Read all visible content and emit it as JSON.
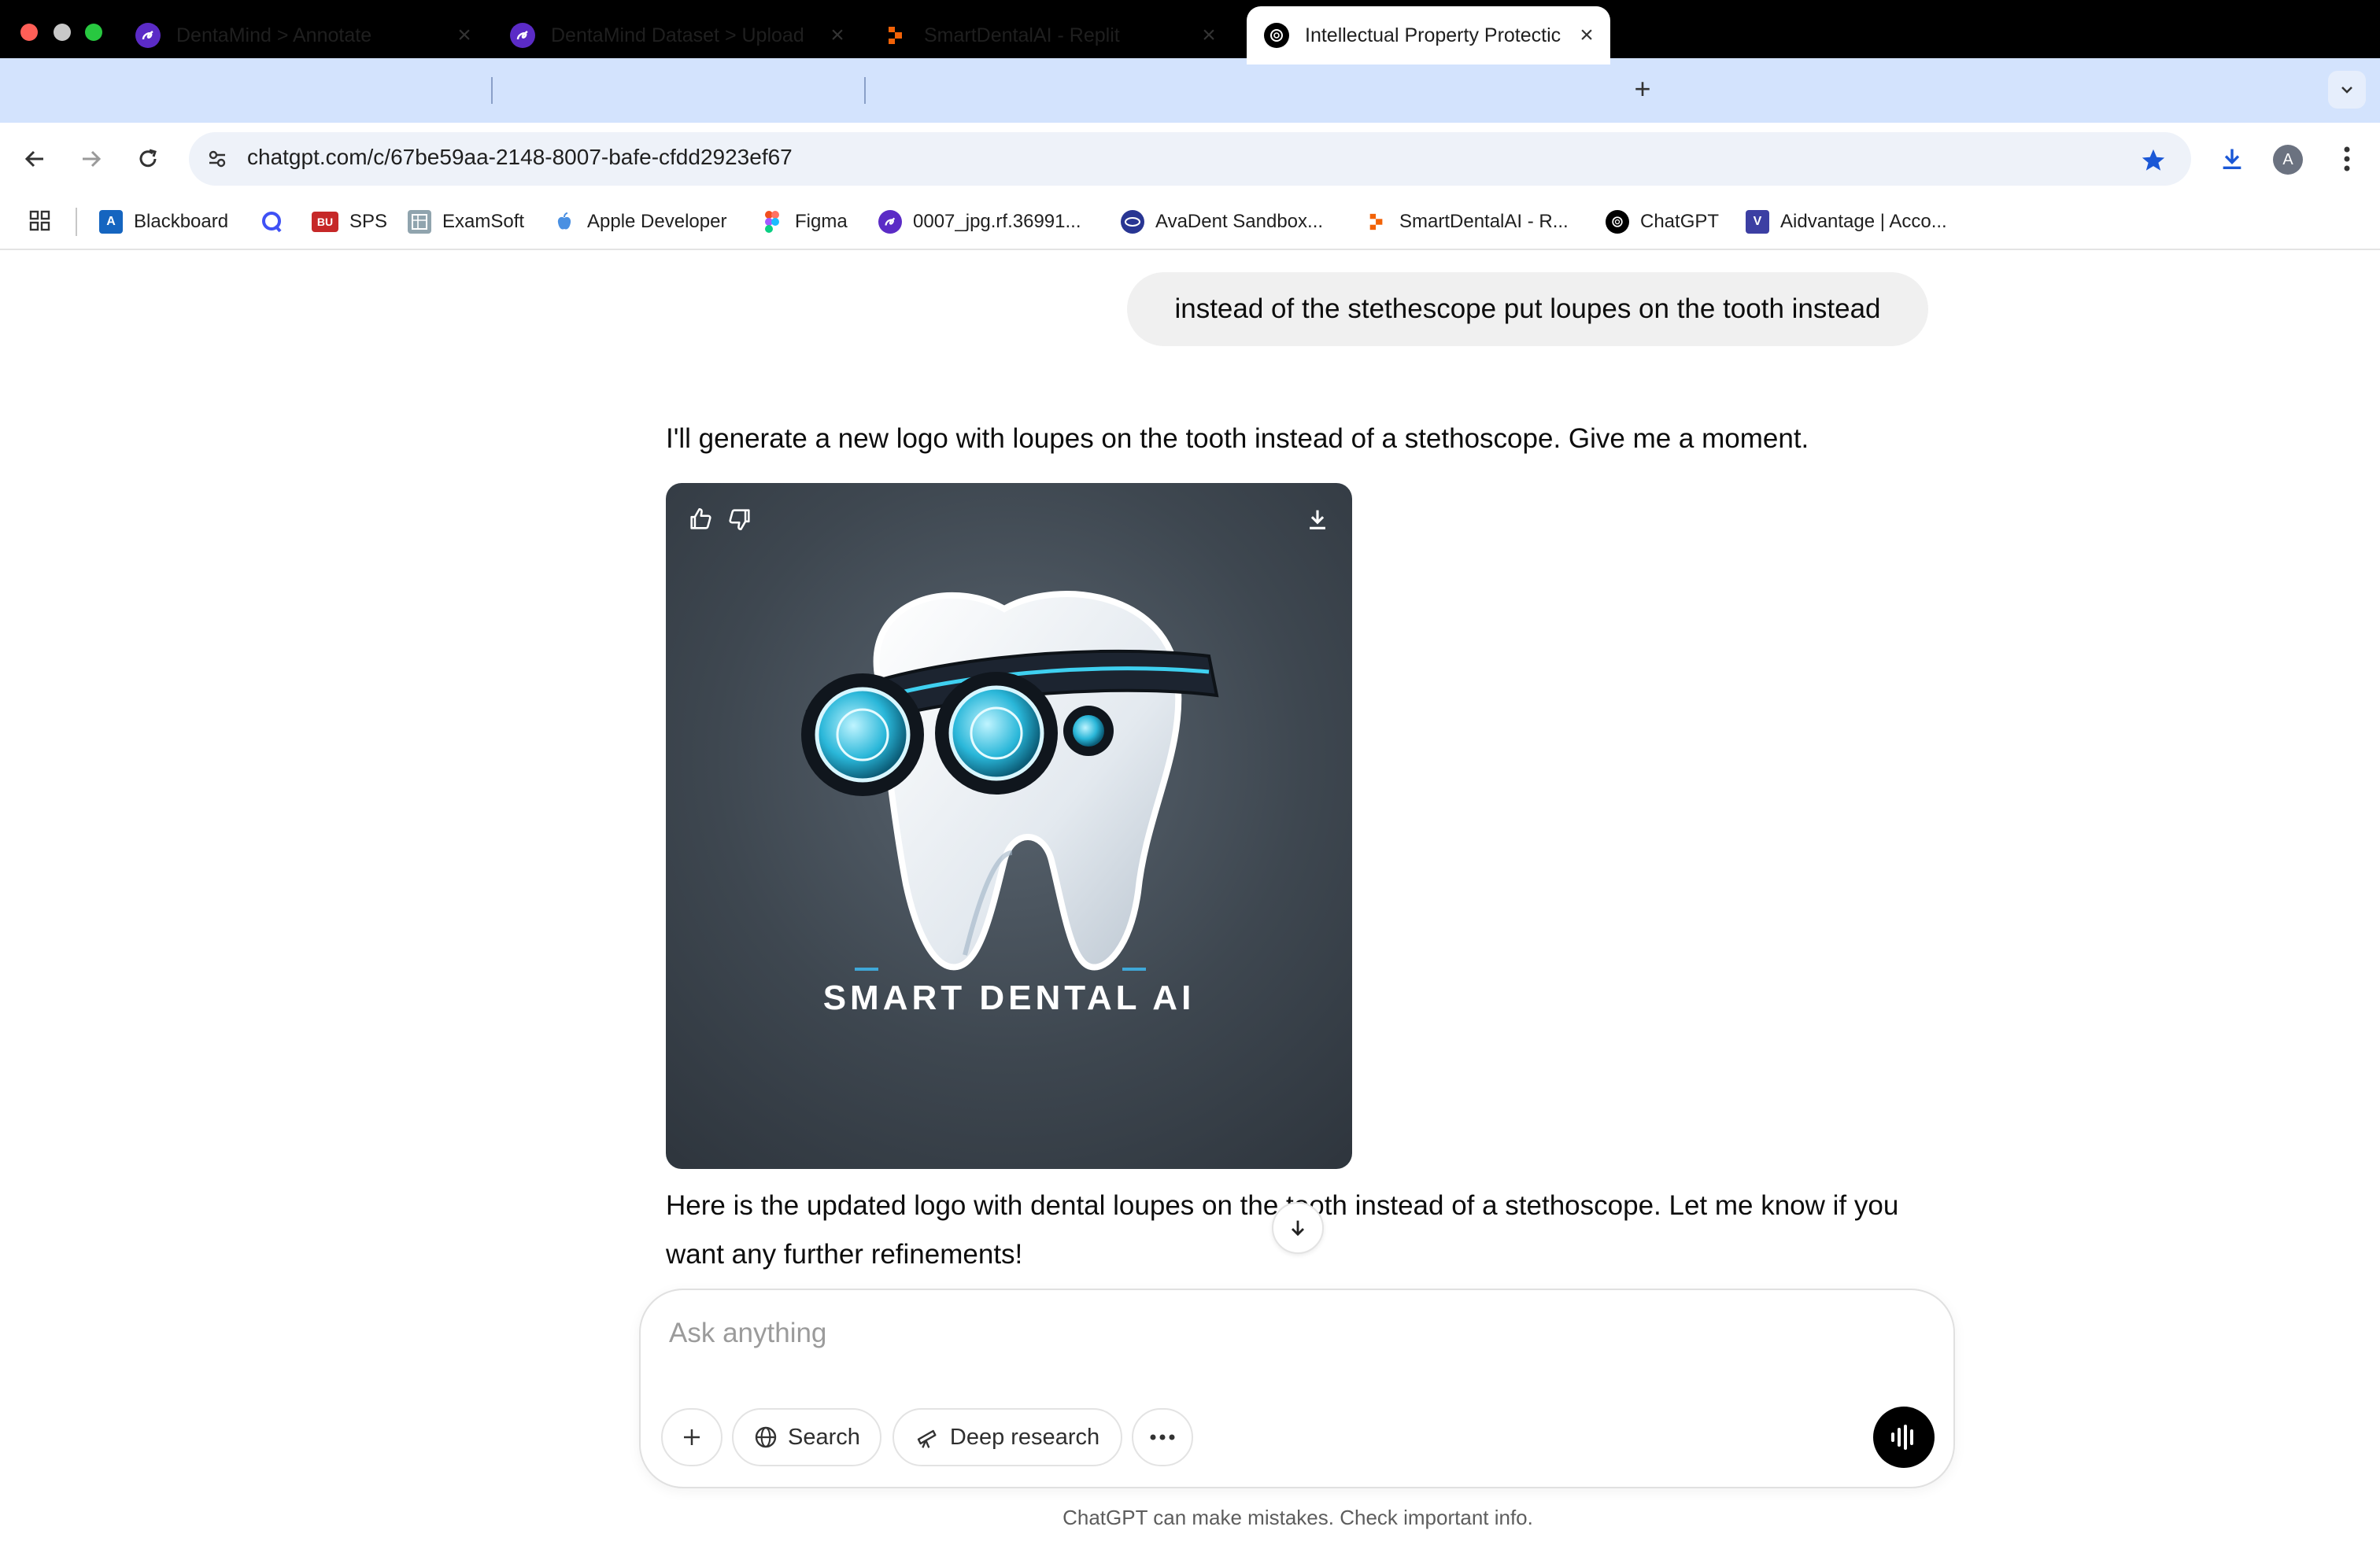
{
  "browser": {
    "tabs": [
      {
        "label": "DentaMind > Annotate",
        "icon": "dentamind-icon"
      },
      {
        "label": "DentaMind Dataset > Upload",
        "icon": "dentamind-icon"
      },
      {
        "label": "SmartDentalAI - Replit",
        "icon": "replit-icon"
      },
      {
        "label": "Intellectual Property Protectic",
        "icon": "chatgpt-icon",
        "active": true
      }
    ],
    "url": "chatgpt.com/c/67be59aa-2148-8007-bafe-cfdd2923ef67",
    "profile_initial": "A",
    "bookmarks": [
      {
        "label": "Blackboard",
        "icon": "blackboard-icon",
        "color": "#1565c0"
      },
      {
        "label": "",
        "icon": "q-icon",
        "color": "#3f51f5"
      },
      {
        "label": "SPS",
        "icon": "bu-icon",
        "color": "#c62828",
        "badge": "BU"
      },
      {
        "label": "ExamSoft",
        "icon": "examsoft-icon",
        "color": "#607d8b"
      },
      {
        "label": "Apple Developer",
        "icon": "apple-icon",
        "color": "#4a90e2"
      },
      {
        "label": "Figma",
        "icon": "figma-icon",
        "color": "#f24e1e"
      },
      {
        "label": "0007_jpg.rf.36991...",
        "icon": "dentamind-icon",
        "color": "#5b2bc6"
      },
      {
        "label": "AvaDent Sandbox...",
        "icon": "avadent-icon",
        "color": "#283593"
      },
      {
        "label": "SmartDentalAI - R...",
        "icon": "replit-icon",
        "color": "#f26207"
      },
      {
        "label": "ChatGPT",
        "icon": "chatgpt-icon",
        "color": "#000000"
      },
      {
        "label": "Aidvantage | Acco...",
        "icon": "aidvantage-icon",
        "color": "#3c3fa3"
      }
    ]
  },
  "chat": {
    "user_message": "instead of the stethescope put loupes on the tooth instead",
    "assistant_intro": "I'll generate a new logo with loupes on the tooth instead of a stethoscope. Give me a moment.",
    "image_caption_text": "SMART DENTAL AI",
    "assistant_followup": "Here is the updated logo with dental loupes on the tooth instead of a stethoscope. Let me know if you want any further refinements!"
  },
  "composer": {
    "placeholder": "Ask anything",
    "search_label": "Search",
    "deep_research_label": "Deep research"
  },
  "disclaimer": "ChatGPT can make mistakes. Check important info.",
  "colors": {
    "tabstrip": "#d3e3fd",
    "accent_star": "#1a57d6",
    "voice_button": "#000000"
  }
}
